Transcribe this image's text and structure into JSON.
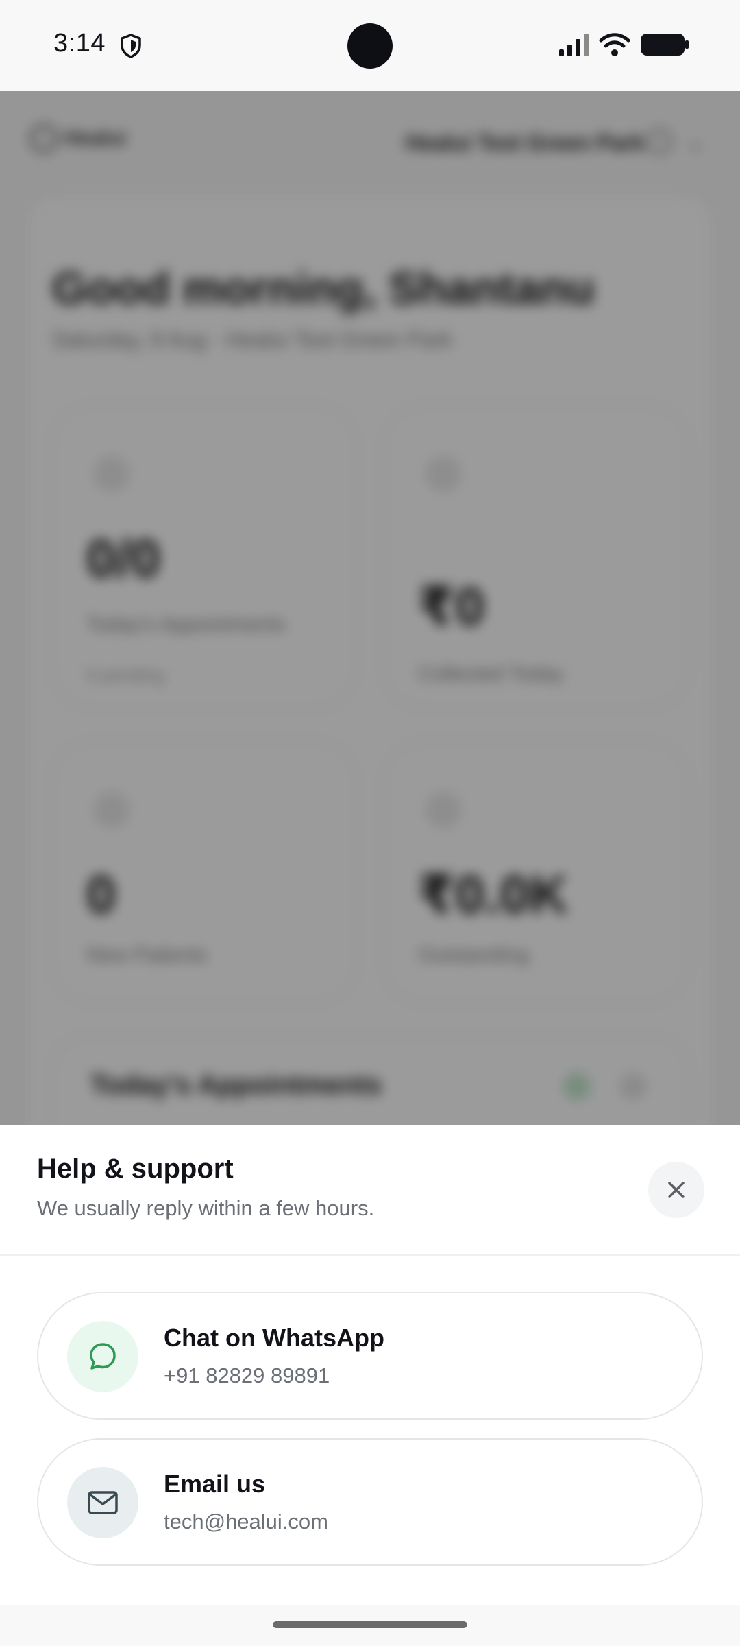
{
  "status_bar": {
    "time": "3:14",
    "icons": [
      "shield-icon",
      "signal-icon",
      "wifi-icon",
      "battery-icon"
    ]
  },
  "background_app": {
    "logo_text": "Healui",
    "clinic_name": "Healui Test Green Park",
    "greeting": "Good morning, Shantanu",
    "subtitle": "Saturday, 9 Aug · Healui Test Green Park",
    "cards": [
      {
        "value": "0/0",
        "label": "Today's Appointments",
        "sublabel": "0 pending"
      },
      {
        "value": "₹0",
        "label": "Collected Today",
        "sublabel": ""
      },
      {
        "value": "0",
        "label": "New Patients",
        "sublabel": ""
      },
      {
        "value": "₹0.0K",
        "label": "Outstanding",
        "sublabel": ""
      }
    ],
    "appointments_title": "Today's Appointments",
    "appointments_badges": [
      "0",
      "0"
    ]
  },
  "sheet": {
    "title": "Help & support",
    "subtitle": "We usually reply within a few hours.",
    "close_icon": "close-icon",
    "options": [
      {
        "title": "Chat on WhatsApp",
        "detail": "+91 82829 89891",
        "icon": "chat-bubble-icon",
        "icon_color": "#2e9a56",
        "icon_bg": "#e9f8ee"
      },
      {
        "title": "Email us",
        "detail": "tech@healui.com",
        "icon": "mail-icon",
        "icon_color": "#3a4a52",
        "icon_bg": "#e8eeef"
      }
    ]
  },
  "colors": {
    "text_primary": "#111318",
    "text_secondary": "#6b6f76",
    "whatsapp_green": "#2e9a56",
    "overlay": "rgba(0,0,0,0.38)"
  }
}
